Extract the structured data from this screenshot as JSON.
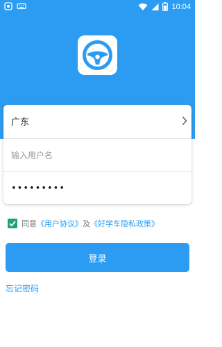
{
  "status_bar": {
    "time": "10:04",
    "icons": [
      "app-notification-icon",
      "keyboard-icon",
      "wifi-icon",
      "signal-icon",
      "battery-icon"
    ]
  },
  "theme": {
    "primary": "#2b9cf2",
    "check": "#1fa46f"
  },
  "logo": {
    "icon": "steering-wheel-icon"
  },
  "form": {
    "region_value": "广东",
    "username_placeholder": "输入用户名",
    "password_value": "123456789"
  },
  "agreement": {
    "checked": true,
    "prefix": "同意",
    "user_agreement": "《用户协议》",
    "conjunction": "及",
    "privacy_policy": "《好学车隐私政策》"
  },
  "login_label": "登录",
  "forgot_password_label": "忘记密码"
}
